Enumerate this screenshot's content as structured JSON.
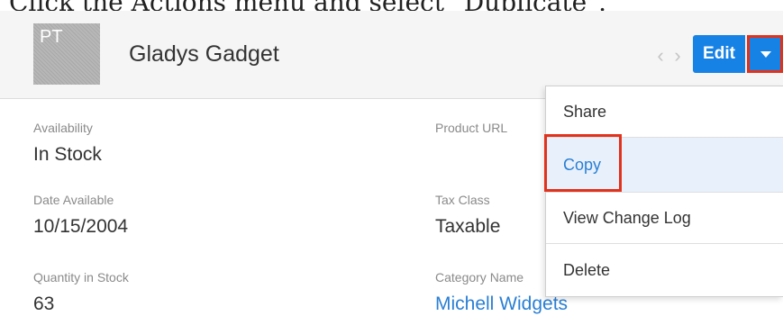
{
  "caption": "Click the Actions menu and select \"Duplicate\".",
  "record": {
    "avatar_initials": "PT",
    "title": "Gladys Gadget"
  },
  "nav": {
    "prev_glyph": "‹",
    "next_glyph": "›"
  },
  "actions": {
    "edit_label": "Edit"
  },
  "fields": {
    "availability": {
      "label": "Availability",
      "value": "In Stock"
    },
    "date_available": {
      "label": "Date Available",
      "value": "10/15/2004"
    },
    "quantity_in_stock": {
      "label": "Quantity in Stock",
      "value": "63"
    },
    "product_url": {
      "label": "Product URL",
      "value": ""
    },
    "tax_class": {
      "label": "Tax Class",
      "value": "Taxable"
    },
    "category_name": {
      "label": "Category Name",
      "value": "Michell Widgets"
    }
  },
  "menu": {
    "items": [
      {
        "label": "Share"
      },
      {
        "label": "Copy"
      },
      {
        "label": "View Change Log"
      },
      {
        "label": "Delete"
      }
    ],
    "selected": "Copy"
  },
  "colors": {
    "accent": "#1782e5",
    "highlight": "#e2321c",
    "link": "#2a7fd4"
  }
}
